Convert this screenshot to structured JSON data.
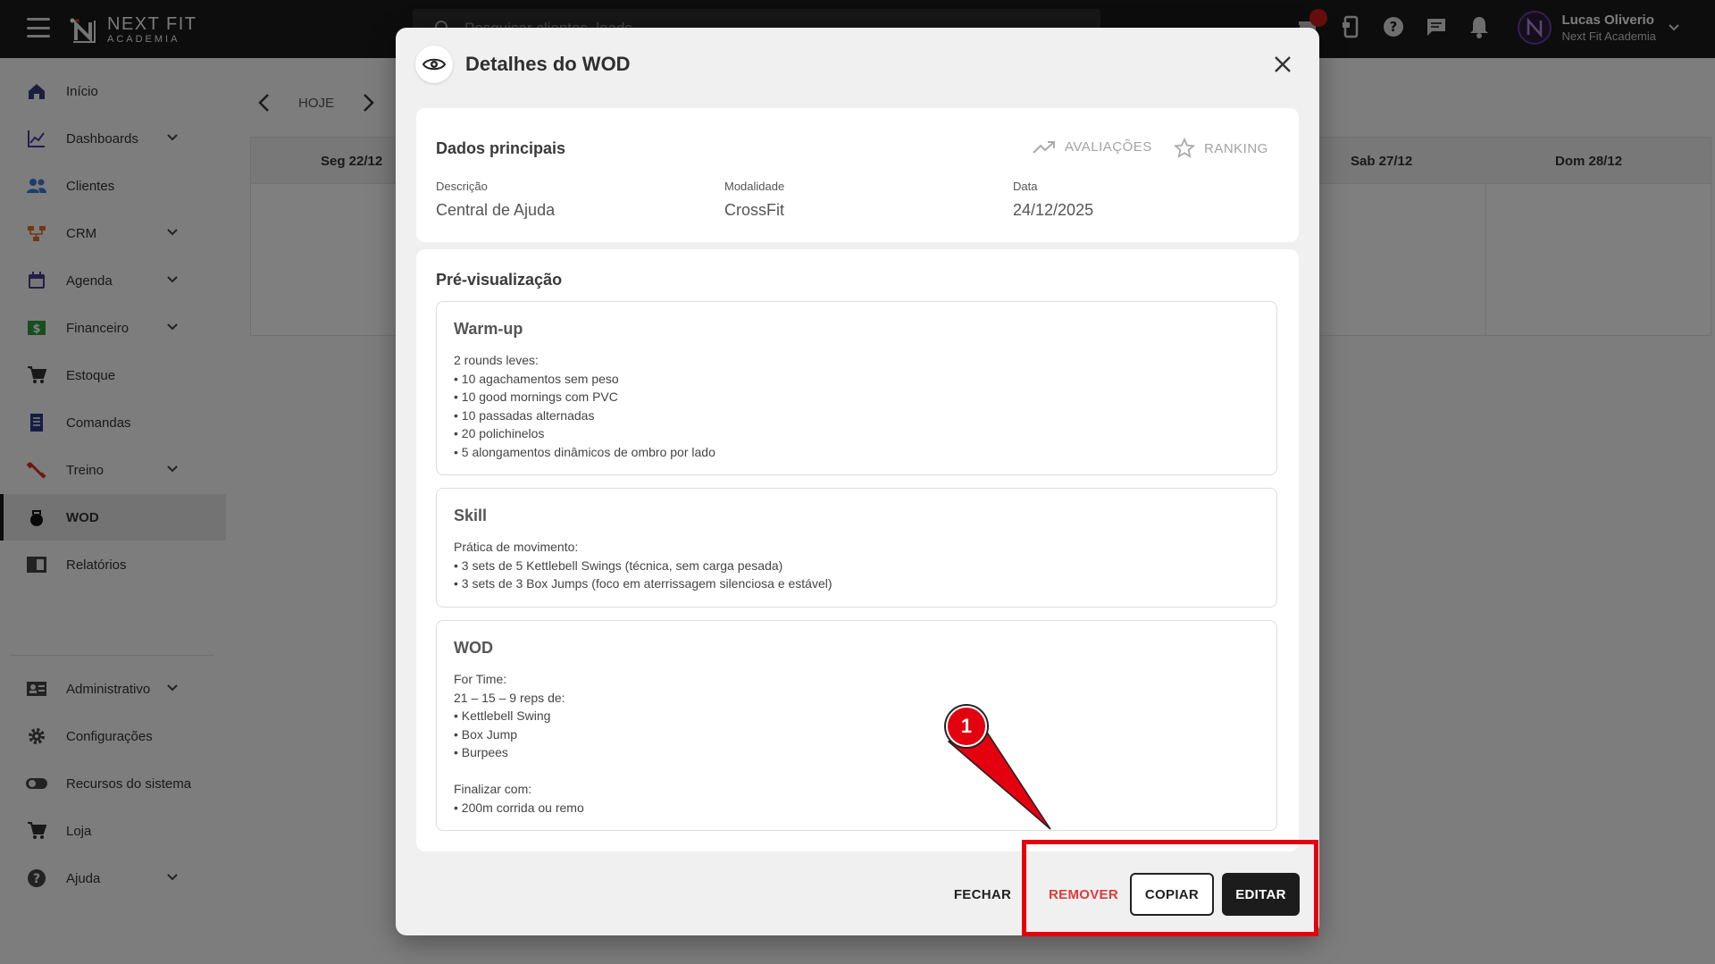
{
  "topbar": {
    "logo_line1": "NEXT FIT",
    "logo_line2": "ACADEMIA",
    "search_placeholder": "Pesquisar clientes, leads...",
    "user_name": "Lucas Oliverio",
    "user_org": "Next Fit Academia"
  },
  "sidebar": {
    "items": [
      {
        "label": "Início",
        "icon": "home-icon"
      },
      {
        "label": "Dashboards",
        "icon": "chart-icon"
      },
      {
        "label": "Clientes",
        "icon": "people-icon"
      },
      {
        "label": "CRM",
        "icon": "crm-icon"
      },
      {
        "label": "Agenda",
        "icon": "calendar-icon"
      },
      {
        "label": "Financeiro",
        "icon": "money-icon"
      },
      {
        "label": "Estoque",
        "icon": "cart-icon"
      },
      {
        "label": "Comandas",
        "icon": "receipt-icon"
      },
      {
        "label": "Treino",
        "icon": "dumbbell-icon"
      },
      {
        "label": "WOD",
        "icon": "kettlebell-icon"
      },
      {
        "label": "Relatórios",
        "icon": "report-icon"
      },
      {
        "label": "Administrativo",
        "icon": "id-card-icon"
      },
      {
        "label": "Configurações",
        "icon": "gear-icon"
      },
      {
        "label": "Recursos do sistema",
        "icon": "toggle-icon"
      },
      {
        "label": "Loja",
        "icon": "cart-icon"
      },
      {
        "label": "Ajuda",
        "icon": "help-icon"
      }
    ]
  },
  "calendar": {
    "today_label": "HOJE",
    "days": [
      "Seg 22/12",
      "Sab 27/12",
      "Dom 28/12"
    ]
  },
  "modal": {
    "title": "Detalhes do WOD",
    "main_title": "Dados principais",
    "avaliacoes_label": "AVALIAÇÕES",
    "ranking_label": "RANKING",
    "fields": {
      "descricao_label": "Descrição",
      "descricao_value": "Central de Ajuda",
      "modalidade_label": "Modalidade",
      "modalidade_value": "CrossFit",
      "data_label": "Data",
      "data_value": "24/12/2025"
    },
    "preview_title": "Pré-visualização",
    "blocks": [
      {
        "title": "Warm-up",
        "lines": [
          "2 rounds leves:",
          "• 10 agachamentos sem peso",
          "• 10 good mornings com PVC",
          "• 10 passadas alternadas",
          "• 20 polichinelos",
          "• 5 alongamentos dinâmicos de ombro por lado"
        ]
      },
      {
        "title": "Skill",
        "lines": [
          "Prática de movimento:",
          "• 3 sets de 5 Kettlebell Swings (técnica, sem carga pesada)",
          "• 3 sets de 3 Box Jumps (foco em aterrissagem silenciosa e estável)"
        ]
      },
      {
        "title": "WOD",
        "lines": [
          "For Time:",
          "21 – 15 – 9 reps de:",
          "• Kettlebell Swing",
          "• Box Jump",
          "• Burpees",
          "",
          "Finalizar com:",
          "• 200m corrida ou remo"
        ]
      }
    ],
    "buttons": {
      "fechar": "FECHAR",
      "remover": "REMOVER",
      "copiar": "COPIAR",
      "editar": "EDITAR"
    }
  },
  "annotation": {
    "number": "1",
    "color": "#e3000f"
  }
}
